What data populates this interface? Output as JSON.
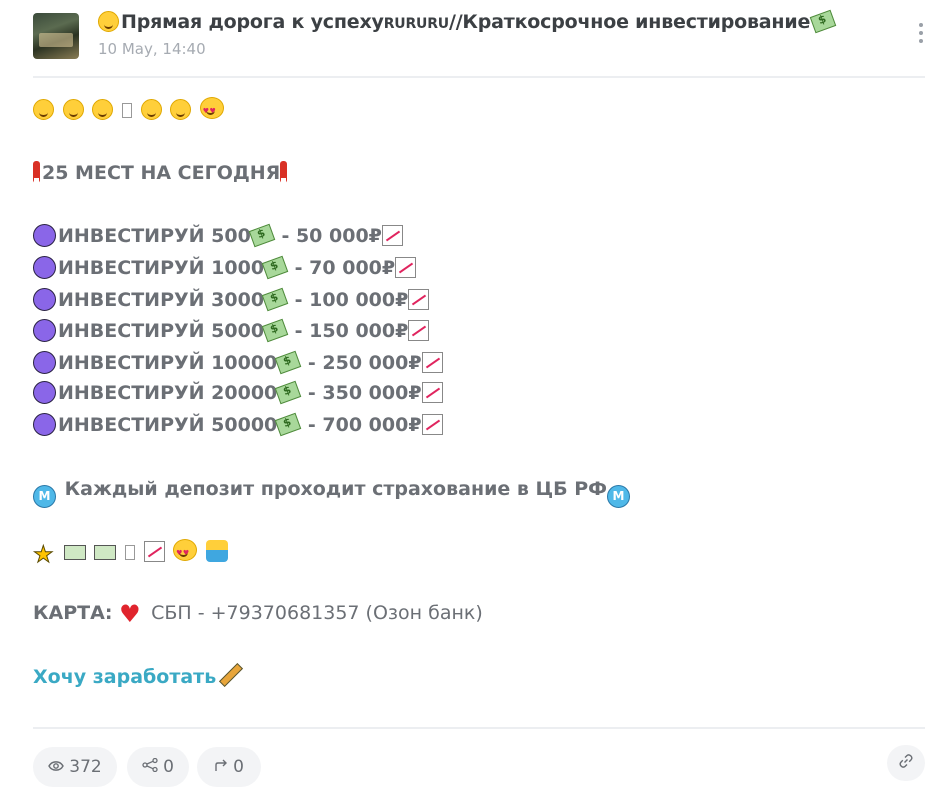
{
  "post": {
    "channel_title": "Прямая дорога к успеху",
    "channel_title_tag": "RURURU",
    "channel_title_rest": "//Краткосрочное инвестирование",
    "date": "10 May, 14:40"
  },
  "content": {
    "headline": "25 МЕСТ НА СЕГОДНЯ",
    "offers": [
      {
        "amount": "ИНВЕСТИРУЙ 500",
        "result": " - 50 000₽"
      },
      {
        "amount": "ИНВЕСТИРУЙ 1000",
        "result": " - 70 000₽"
      },
      {
        "amount": "ИНВЕСТИРУЙ 3000",
        "result": " - 100 000₽"
      },
      {
        "amount": "ИНВЕСТИРУЙ 5000",
        "result": " - 150 000₽"
      },
      {
        "amount": "ИНВЕСТИРУЙ 10000",
        "result": " - 250 000₽"
      },
      {
        "amount": "ИНВЕСТИРУЙ 20000",
        "result": " - 350 000₽"
      },
      {
        "amount": "ИНВЕСТИРУЙ 50000",
        "result": " - 700 000₽"
      }
    ],
    "insurance": " Каждый депозит проходит страхование в ЦБ РФ",
    "card_label": "КАРТА:",
    "card_details": " СБП - +79370681357 (Озон банк)",
    "cta_link": "Хочу заработать",
    "metro_letter": "M"
  },
  "footer": {
    "views": "372",
    "shares": "0",
    "forwards": "0"
  },
  "icons": {
    "eye": "eye-icon",
    "share": "share-icon",
    "forward": "forward-icon",
    "link": "link-icon",
    "menu": "kebab-menu-icon"
  },
  "colors": {
    "accent_link": "#3aa9c4",
    "bullet": "#8a66e8",
    "text": "#6b6f75"
  }
}
